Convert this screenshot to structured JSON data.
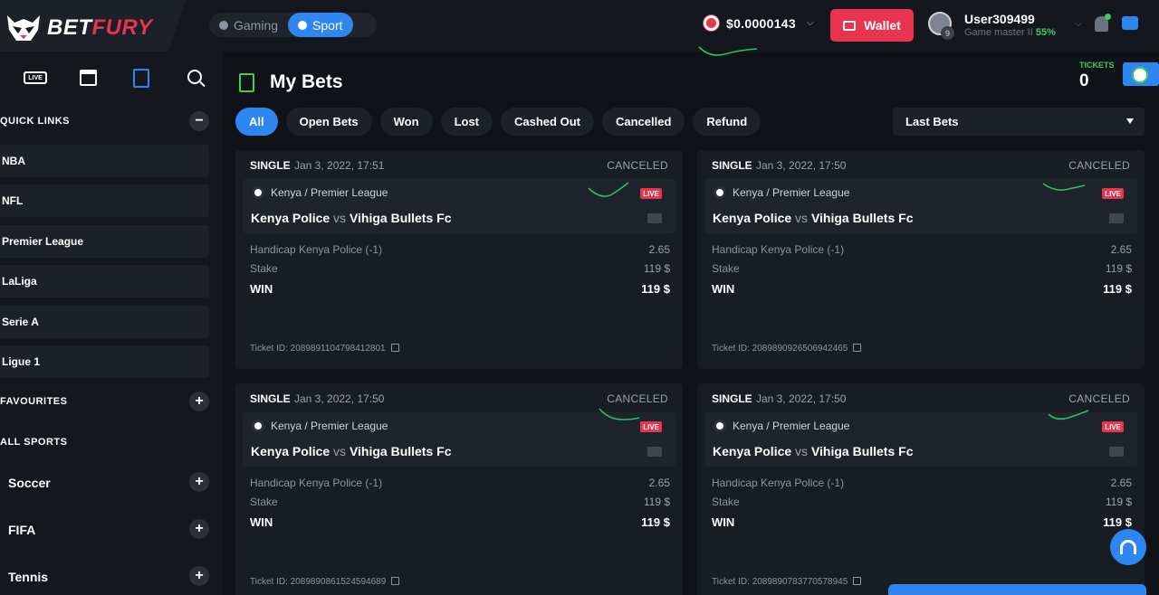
{
  "header": {
    "logo": {
      "part1": "BET",
      "part2": "FURY"
    },
    "modes": [
      {
        "label": "Gaming",
        "active": false
      },
      {
        "label": "Sport",
        "active": true
      }
    ],
    "balance": "$0.0000143",
    "wallet_label": "Wallet",
    "user": {
      "name": "User309499",
      "rank": "Game master II",
      "progress": "55%",
      "level": "9"
    }
  },
  "sidebar": {
    "tools": [
      "LIVE"
    ],
    "quick_links_title": "QUICK LINKS",
    "quick_links": [
      "NBA",
      "NFL",
      "Premier League",
      "LaLiga",
      "Serie A",
      "Ligue 1"
    ],
    "favourites_title": "FAVOURITES",
    "all_sports_title": "ALL SPORTS",
    "sports": [
      "Soccer",
      "FIFA",
      "Tennis"
    ],
    "collapse_symbol": "−",
    "expand_symbol": "+"
  },
  "main": {
    "title": "My Bets",
    "tickets": {
      "label": "TICKETS",
      "count": "0"
    },
    "filters": [
      {
        "label": "All",
        "active": true
      },
      {
        "label": "Open Bets",
        "active": false
      },
      {
        "label": "Won",
        "active": false
      },
      {
        "label": "Lost",
        "active": false
      },
      {
        "label": "Cashed Out",
        "active": false
      },
      {
        "label": "Cancelled",
        "active": false
      },
      {
        "label": "Refund",
        "active": false
      }
    ],
    "sort_label": "Last Bets",
    "bets": [
      {
        "type": "SINGLE",
        "date": "Jan 3, 2022, 17:51",
        "status": "CANCELED",
        "league": "Kenya / Premier League",
        "live": "LIVE",
        "home": "Kenya Police",
        "vs": "vs",
        "away": "Vihiga Bullets Fc",
        "market": "Handicap Kenya Police (-1)",
        "odds": "2.65",
        "stake_label": "Stake",
        "stake": "119 $",
        "win_label": "WIN",
        "win": "119 $",
        "ticket": "Ticket ID: 2089891104798412801"
      },
      {
        "type": "SINGLE",
        "date": "Jan 3, 2022, 17:50",
        "status": "CANCELED",
        "league": "Kenya / Premier League",
        "live": "LIVE",
        "home": "Kenya Police",
        "vs": "vs",
        "away": "Vihiga Bullets Fc",
        "market": "Handicap Kenya Police (-1)",
        "odds": "2.65",
        "stake_label": "Stake",
        "stake": "119 $",
        "win_label": "WIN",
        "win": "119 $",
        "ticket": "Ticket ID: 2089890926506942465"
      },
      {
        "type": "SINGLE",
        "date": "Jan 3, 2022, 17:50",
        "status": "CANCELED",
        "league": "Kenya / Premier League",
        "live": "LIVE",
        "home": "Kenya Police",
        "vs": "vs",
        "away": "Vihiga Bullets Fc",
        "market": "Handicap Kenya Police (-1)",
        "odds": "2.65",
        "stake_label": "Stake",
        "stake": "119 $",
        "win_label": "WIN",
        "win": "119 $",
        "ticket": "Ticket ID: 2089890861524594689"
      },
      {
        "type": "SINGLE",
        "date": "Jan 3, 2022, 17:50",
        "status": "CANCELED",
        "league": "Kenya / Premier League",
        "live": "LIVE",
        "home": "Kenya Police",
        "vs": "vs",
        "away": "Vihiga Bullets Fc",
        "market": "Handicap Kenya Police (-1)",
        "odds": "2.65",
        "stake_label": "Stake",
        "stake": "119 $",
        "win_label": "WIN",
        "win": "119 $",
        "ticket": "Ticket ID: 2089890783770578945"
      }
    ]
  },
  "colors": {
    "accent": "#2e86f0",
    "brand": "#e8344e",
    "positive": "#3fce55",
    "annotation": "#22c55e"
  }
}
